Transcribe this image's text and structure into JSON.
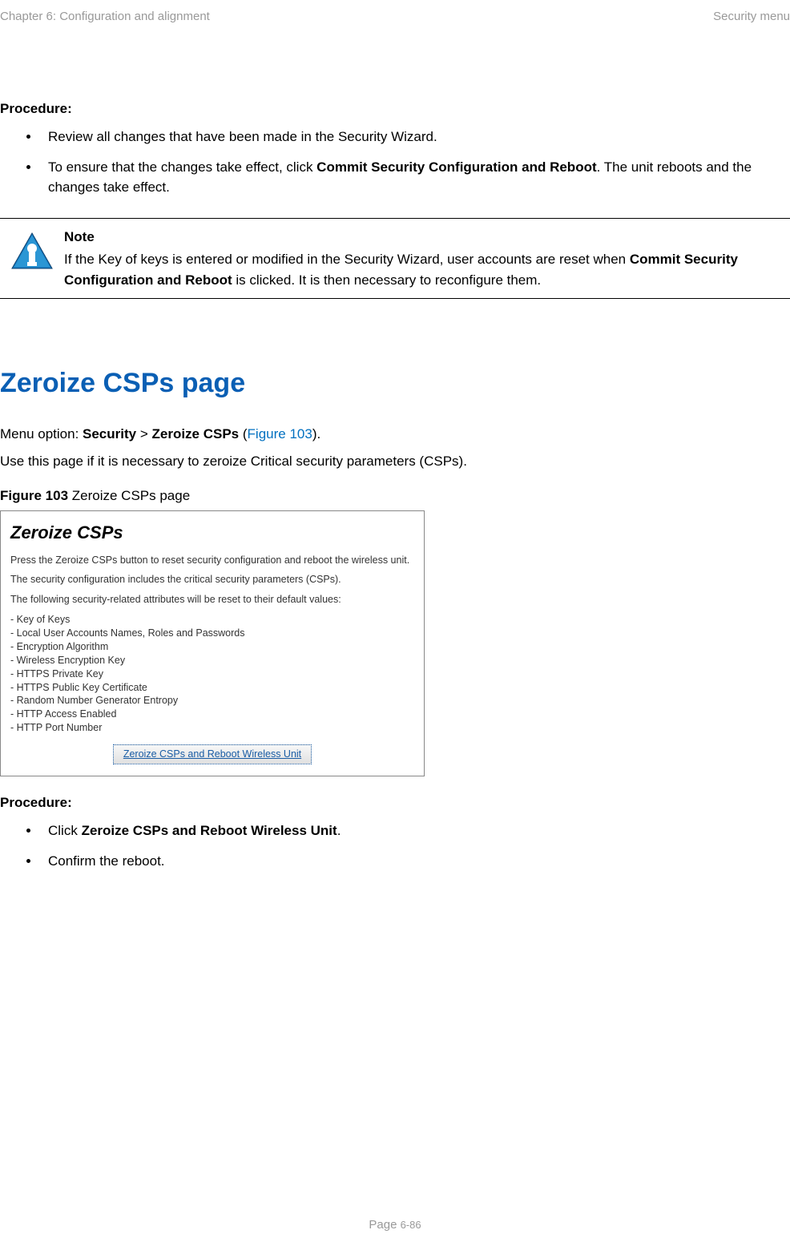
{
  "header": {
    "left": "Chapter 6:  Configuration and alignment",
    "right": "Security menu"
  },
  "procedure1": {
    "heading": "Procedure:",
    "items": [
      {
        "pre": "Review all changes that have been made in the Security Wizard.",
        "bold": "",
        "post": ""
      },
      {
        "pre": "To ensure that the changes take effect, click ",
        "bold": "Commit Security Configuration and Reboot",
        "post": ". The unit reboots and the changes take effect."
      }
    ]
  },
  "note": {
    "label": "Note",
    "pre": "If the Key of keys is entered or modified in the Security Wizard, user accounts are reset when ",
    "bold": "Commit Security Configuration and Reboot",
    "post": " is clicked. It is then necessary to reconfigure them."
  },
  "section": {
    "title": "Zeroize CSPs page",
    "menu_pre": "Menu option: ",
    "menu_bold1": "Security",
    "menu_gt": " > ",
    "menu_bold2": "Zeroize CSPs",
    "menu_open": " (",
    "menu_link": "Figure 103",
    "menu_close": ").",
    "desc": "Use this page if it is necessary to zeroize Critical security parameters (CSPs)."
  },
  "figure": {
    "caption_bold": "Figure 103",
    "caption_rest": "  Zeroize CSPs page",
    "title": "Zeroize CSPs",
    "p1": "Press the Zeroize CSPs button to reset security configuration and reboot the wireless unit.",
    "p2": "The security configuration includes the critical security parameters (CSPs).",
    "p3": "The following security-related attributes will be reset to their default values:",
    "list_items": [
      "- Key of Keys",
      "- Local User Accounts Names, Roles and Passwords",
      "- Encryption Algorithm",
      "- Wireless Encryption Key",
      "- HTTPS Private Key",
      "- HTTPS Public Key Certificate",
      "- Random Number Generator Entropy",
      "- HTTP Access Enabled",
      "- HTTP Port Number"
    ],
    "button": "Zeroize CSPs and Reboot Wireless Unit"
  },
  "procedure2": {
    "heading": "Procedure:",
    "items": [
      {
        "pre": "Click ",
        "bold": "Zeroize CSPs and Reboot Wireless Unit",
        "post": "."
      },
      {
        "pre": "Confirm the reboot.",
        "bold": "",
        "post": ""
      }
    ]
  },
  "footer": {
    "label": "Page ",
    "num": "6-86"
  }
}
